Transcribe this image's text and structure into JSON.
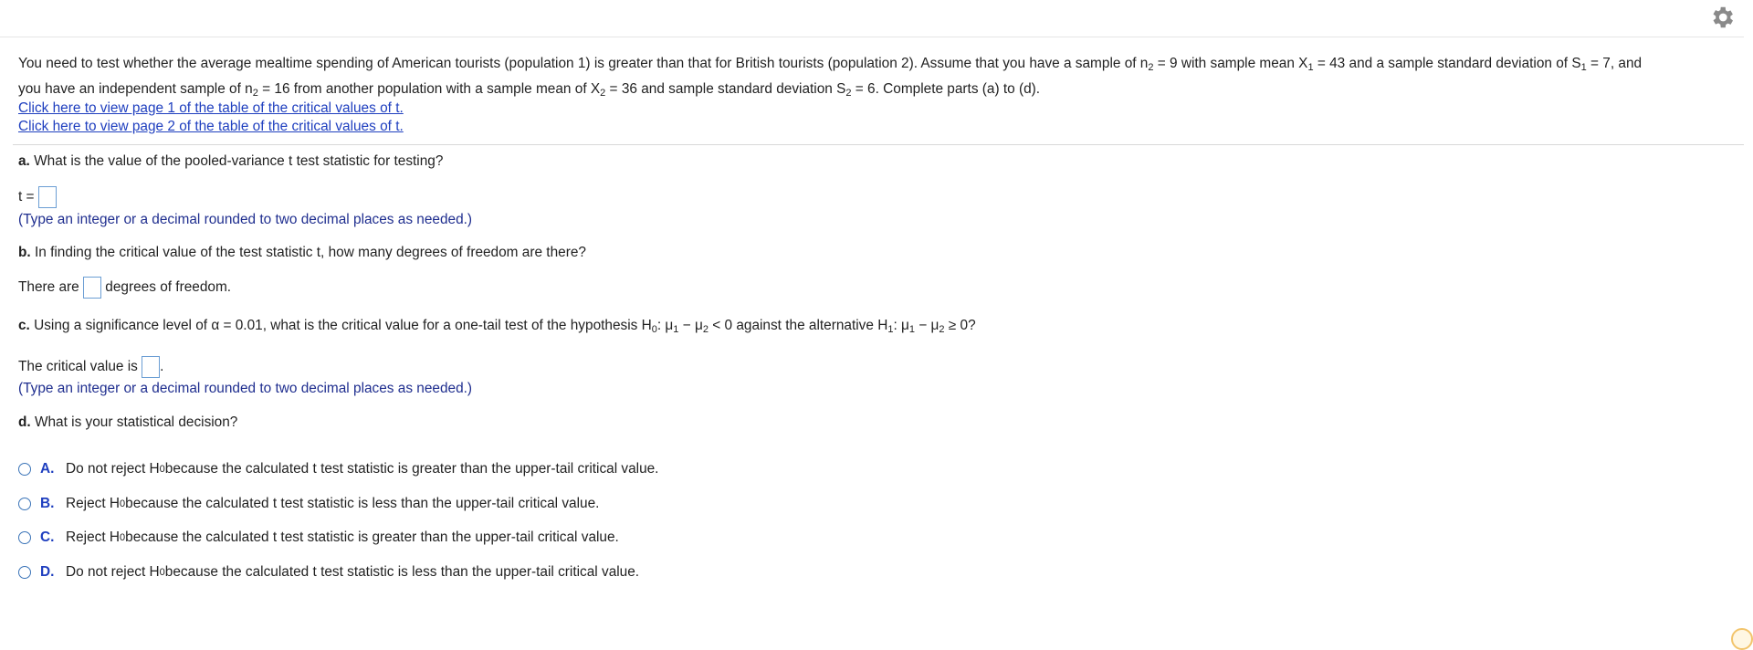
{
  "settings_icon": "gear-icon",
  "problem": {
    "s1": "You need to test whether the average mealtime spending of American tourists (population 1) is greater than that for British tourists (population 2). Assume that you have a sample of n",
    "s2": " = 9 with sample mean X",
    "s3": " = 43 and a sample standard deviation of S",
    "s4": " = 7, and",
    "s5": "you have an independent sample of n",
    "s6": " = 16 from another population with a sample mean of X",
    "s7": " = 36 and sample standard deviation S",
    "s8": " = 6. Complete parts (a) to (d).",
    "sub1": "1",
    "sub2": "2"
  },
  "links": {
    "page1": "Click here to view page 1 of the table of the critical values of t.",
    "page2": "Click here to view page 2 of the table of the critical values of t."
  },
  "part_a": {
    "label": "a.",
    "question": " What is the value of the pooled-variance t test statistic for testing?",
    "prefix": "t =",
    "hint": "(Type an integer or a decimal rounded to two decimal places as needed.)"
  },
  "part_b": {
    "label": "b.",
    "question": " In finding the critical value of the test statistic t, how many degrees of freedom are there?",
    "prefix": "There are",
    "suffix": "degrees of freedom."
  },
  "part_c": {
    "label": "c.",
    "q1": " Using a significance level of α = 0.01, what is the critical value for a one-tail test of the hypothesis H",
    "q2": ": μ",
    "q3": " − μ",
    "q4": " < 0 against the alternative H",
    "q5": ": μ",
    "q6": " − μ",
    "q7": " ≥ 0?",
    "sub0": "0",
    "sub1": "1",
    "sub2": "2",
    "prefix": "The critical value is",
    "suffix": ".",
    "hint": "(Type an integer or a decimal rounded to two decimal places as needed.)"
  },
  "part_d": {
    "label": "d.",
    "question": " What is your statistical decision?",
    "h_letter": "H",
    "h_sub": "0",
    "options": [
      {
        "letter": "A.",
        "pre": "Do not reject",
        "post": " because the calculated t test statistic is greater than the upper-tail critical value."
      },
      {
        "letter": "B.",
        "pre": "Reject",
        "post": " because the calculated t test statistic is less than the upper-tail critical value."
      },
      {
        "letter": "C.",
        "pre": "Reject",
        "post": " because the calculated t test statistic is greater than the upper-tail critical value."
      },
      {
        "letter": "D.",
        "pre": "Do not reject",
        "post": " because the calculated t test statistic is less than the upper-tail critical value."
      }
    ]
  }
}
